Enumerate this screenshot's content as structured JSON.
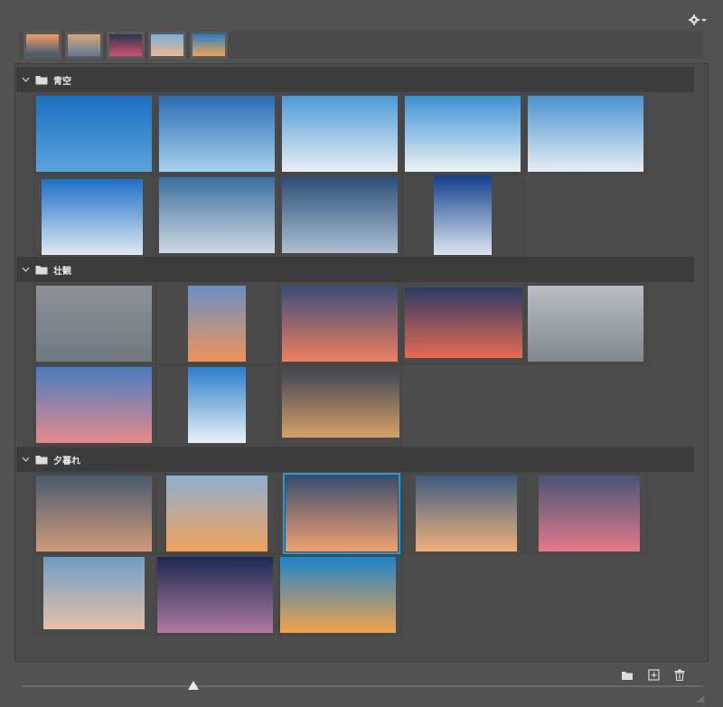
{
  "toolbar": {
    "settings_icon": "gear-icon"
  },
  "recent_presets": [
    {
      "name": "recent-preset-1",
      "colors": [
        "#f19a6a",
        "#3c5876"
      ]
    },
    {
      "name": "recent-preset-2",
      "colors": [
        "#d8a77a",
        "#5c7a98"
      ]
    },
    {
      "name": "recent-preset-3",
      "colors": [
        "#2d3550",
        "#d0506e"
      ]
    },
    {
      "name": "recent-preset-4",
      "colors": [
        "#7ab0d8",
        "#f0b88a"
      ]
    },
    {
      "name": "recent-preset-5",
      "colors": [
        "#2f7ec6",
        "#f0a44a"
      ]
    }
  ],
  "groups": [
    {
      "label": "青空",
      "thumbs": [
        {
          "name": "sky-thumb-1",
          "colors": [
            "#1b6fbf",
            "#5ba3dc"
          ]
        },
        {
          "name": "sky-thumb-2",
          "colors": [
            "#2a6db3",
            "#a8d0ee"
          ]
        },
        {
          "name": "sky-thumb-3",
          "colors": [
            "#4b9bd6",
            "#e9eef2"
          ]
        },
        {
          "name": "sky-thumb-4",
          "colors": [
            "#3c91d2",
            "#eef2f4"
          ]
        },
        {
          "name": "sky-thumb-5",
          "colors": [
            "#4a92cf",
            "#e6edf2"
          ]
        },
        {
          "name": "sky-thumb-6",
          "colors": [
            "#1e6fc8",
            "#dfe9f2"
          ]
        },
        {
          "name": "sky-thumb-7",
          "colors": [
            "#3b6f9d",
            "#cfd9e1"
          ]
        },
        {
          "name": "sky-thumb-8",
          "colors": [
            "#2c4f79",
            "#aebfd0"
          ]
        },
        {
          "name": "sky-thumb-9",
          "colors": [
            "#123f8c",
            "#dde6f0"
          ]
        }
      ]
    },
    {
      "label": "壮観",
      "thumbs": [
        {
          "name": "scenic-thumb-1",
          "colors": [
            "#8d9196",
            "#6f7982"
          ]
        },
        {
          "name": "scenic-thumb-2",
          "colors": [
            "#6a8fbf",
            "#f0935a"
          ]
        },
        {
          "name": "scenic-thumb-3",
          "colors": [
            "#3a4c78",
            "#ef8060"
          ]
        },
        {
          "name": "scenic-thumb-4",
          "colors": [
            "#2c3b64",
            "#e86a52"
          ]
        },
        {
          "name": "scenic-thumb-5",
          "colors": [
            "#b9bec4",
            "#7f868e"
          ]
        },
        {
          "name": "scenic-thumb-6",
          "colors": [
            "#4b7bbf",
            "#e58b8a"
          ]
        },
        {
          "name": "scenic-thumb-7",
          "colors": [
            "#2d7fca",
            "#e9f0f6"
          ]
        },
        {
          "name": "scenic-thumb-8",
          "colors": [
            "#454a55",
            "#d8a068"
          ]
        }
      ]
    },
    {
      "label": "夕暮れ",
      "thumbs": [
        {
          "name": "dusk-thumb-1",
          "colors": [
            "#4a5a70",
            "#d09a78"
          ]
        },
        {
          "name": "dusk-thumb-2",
          "colors": [
            "#8eb0cf",
            "#f0a35a"
          ]
        },
        {
          "name": "dusk-thumb-3",
          "colors": [
            "#394b6e",
            "#f0a070"
          ]
        },
        {
          "name": "dusk-thumb-4",
          "colors": [
            "#3e5c82",
            "#f1b07a"
          ]
        },
        {
          "name": "dusk-thumb-5",
          "colors": [
            "#4a5478",
            "#e27988"
          ]
        },
        {
          "name": "dusk-thumb-6",
          "colors": [
            "#6f9dc8",
            "#e6c0a8"
          ]
        },
        {
          "name": "dusk-thumb-7",
          "colors": [
            "#1b2a55",
            "#b07a9c"
          ]
        },
        {
          "name": "dusk-thumb-8",
          "colors": [
            "#1e84c9",
            "#f3a24c"
          ]
        }
      ]
    }
  ],
  "selected": "dusk-thumb-3",
  "footer": {
    "icons": [
      "new-group-folder-icon",
      "new-preset-icon",
      "trash-icon"
    ],
    "size_slider": 0.25
  },
  "accent_color": "#1aa0e0"
}
